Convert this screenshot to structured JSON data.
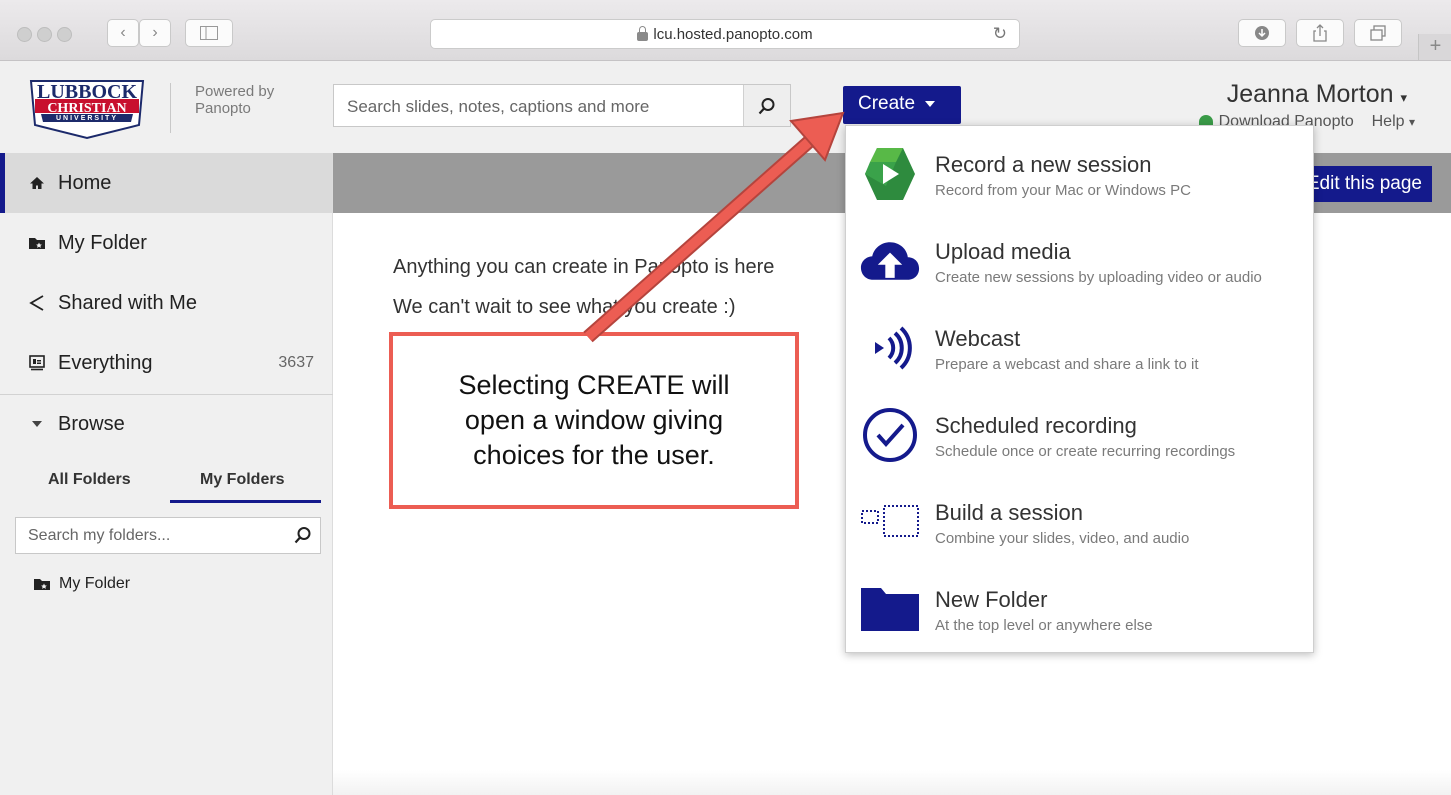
{
  "browser": {
    "url": "lcu.hosted.panopto.com",
    "nav_back_glyph": "‹",
    "nav_forward_glyph": "›",
    "reload_glyph": "↻",
    "new_tab_glyph": "+"
  },
  "header": {
    "logo": {
      "line1": "LUBBOCK",
      "line2": "CHRISTIAN",
      "line3": "UNIVERSITY"
    },
    "powered_by": "Powered by",
    "powered_name": "Panopto",
    "search_placeholder": "Search slides, notes, captions and more",
    "create_label": "Create",
    "user_name": "Jeanna Morton",
    "user_caret": "▾",
    "download_label": "Download Panopto",
    "help_label": "Help",
    "help_caret": "▾"
  },
  "sidebar": {
    "nav": [
      {
        "label": "Home",
        "icon": "home-icon",
        "active": true
      },
      {
        "label": "My Folder",
        "icon": "folder-star-icon"
      },
      {
        "label": "Shared with Me",
        "icon": "share-icon"
      },
      {
        "label": "Everything",
        "icon": "presentation-icon",
        "count": "3637"
      }
    ],
    "browse_label": "Browse",
    "tabs": {
      "all_folders": "All Folders",
      "my_folders": "My Folders",
      "active": "my_folders"
    },
    "folder_search_placeholder": "Search my folders...",
    "tree": [
      {
        "label": "My Folder"
      }
    ]
  },
  "main": {
    "edit_page_label": "Edit this page",
    "intro_line1": "Anything you can create in Panopto is here",
    "intro_line2": "We can't wait to see what you create :)"
  },
  "create_menu": [
    {
      "title": "Record a new session",
      "subtitle": "Record from your Mac or Windows PC",
      "icon": "panopto-record-icon"
    },
    {
      "title": "Upload media",
      "subtitle": "Create new sessions by uploading video or audio",
      "icon": "cloud-upload-icon"
    },
    {
      "title": "Webcast",
      "subtitle": "Prepare a webcast and share a link to it",
      "icon": "broadcast-icon"
    },
    {
      "title": "Scheduled recording",
      "subtitle": "Schedule once or create recurring recordings",
      "icon": "clock-icon"
    },
    {
      "title": "Build a session",
      "subtitle": "Combine your slides, video, and audio",
      "icon": "build-session-icon"
    },
    {
      "title": "New Folder",
      "subtitle": "At the top level or anywhere else",
      "icon": "folder-icon"
    }
  ],
  "annotation": {
    "callout_text": "Selecting CREATE will open a window giving choices for the user.",
    "arrow_color": "#ec5d53"
  },
  "colors": {
    "brand_blue": "#141a8c",
    "sidebar_bg": "#f0f0f0",
    "graybar": "#9a9a9a",
    "logo_red": "#c8102e",
    "logo_navy": "#1c2a6b"
  }
}
